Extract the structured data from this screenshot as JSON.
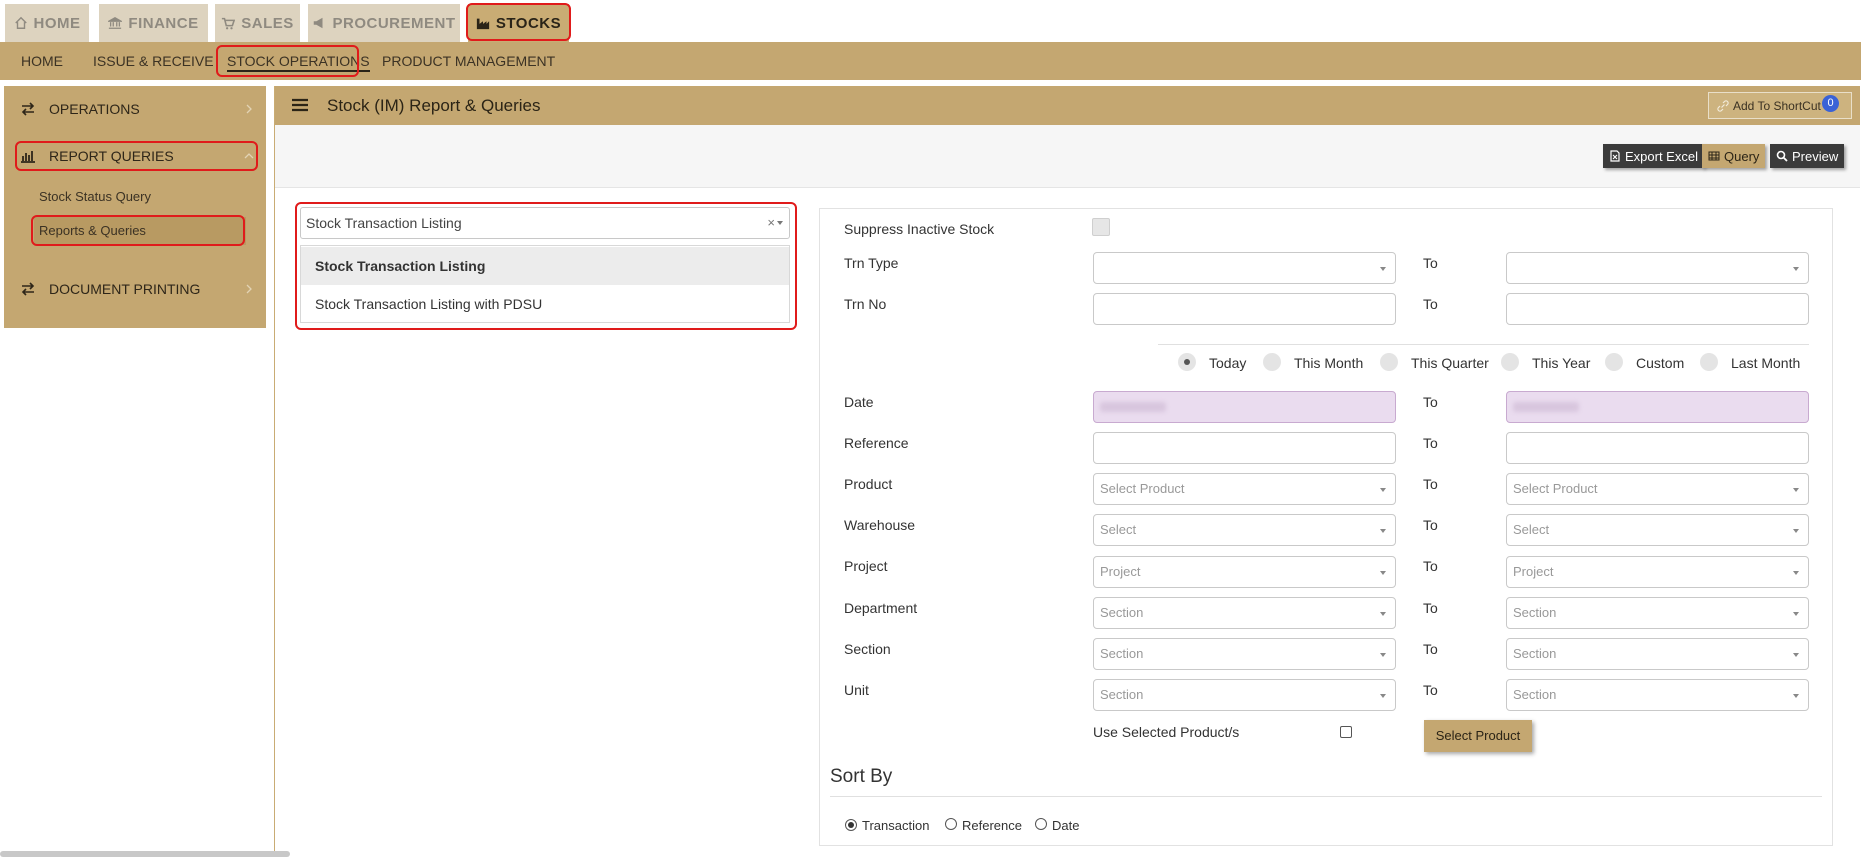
{
  "top_tabs": [
    {
      "label": "HOME",
      "icon": "home-icon"
    },
    {
      "label": "FINANCE",
      "icon": "bank-icon"
    },
    {
      "label": "SALES",
      "icon": "cart-icon"
    },
    {
      "label": "PROCUREMENT",
      "icon": "megaphone-icon"
    },
    {
      "label": "STOCKS",
      "icon": "factory-icon",
      "active": true
    }
  ],
  "sub_nav": [
    "HOME",
    "ISSUE & RECEIVE",
    "STOCK OPERATIONS",
    "PRODUCT MANAGEMENT"
  ],
  "sidebar": {
    "sections": [
      {
        "label": "OPERATIONS",
        "icon": "exchange-icon"
      },
      {
        "label": "REPORT QUERIES",
        "icon": "bar-chart-icon",
        "expanded": true
      },
      {
        "label": "DOCUMENT PRINTING",
        "icon": "exchange-icon"
      }
    ],
    "report_items": [
      "Stock Status Query",
      "Reports & Queries"
    ]
  },
  "panel": {
    "title": "Stock (IM) Report & Queries",
    "shortcut_label": "Add To ShortCut",
    "shortcut_count": "0",
    "toolbar": {
      "export_excel": "Export Excel",
      "query": "Query",
      "preview": "Preview"
    }
  },
  "report_select": {
    "value": "Stock Transaction Listing",
    "clear": "×",
    "options": [
      "Stock Transaction Listing",
      "Stock Transaction Listing with PDSU"
    ]
  },
  "form": {
    "suppress_label": "Suppress Inactive Stock",
    "to_label": "To",
    "trn_type": "Trn Type",
    "trn_no": "Trn No",
    "date_range_options": [
      "Today",
      "This Month",
      "This Quarter",
      "This Year",
      "Custom",
      "Last Month"
    ],
    "date_range_selected": "Today",
    "date": "Date",
    "reference": "Reference",
    "product": "Product",
    "product_placeholder": "Select Product",
    "warehouse": "Warehouse",
    "warehouse_placeholder": "Select",
    "project": "Project",
    "project_placeholder": "Project",
    "department": "Department",
    "department_placeholder": "Section",
    "section": "Section",
    "section_placeholder": "Section",
    "unit": "Unit",
    "unit_placeholder": "Section",
    "use_selected": "Use Selected Product/s",
    "select_product_button": "Select Product",
    "sort_by": "Sort By",
    "sort_options": [
      "Transaction",
      "Reference",
      "Date"
    ],
    "sort_selected": "Transaction"
  },
  "colors": {
    "accent": "#c4a771",
    "highlight": "#e01b1b",
    "date_field": "#eadcef"
  }
}
